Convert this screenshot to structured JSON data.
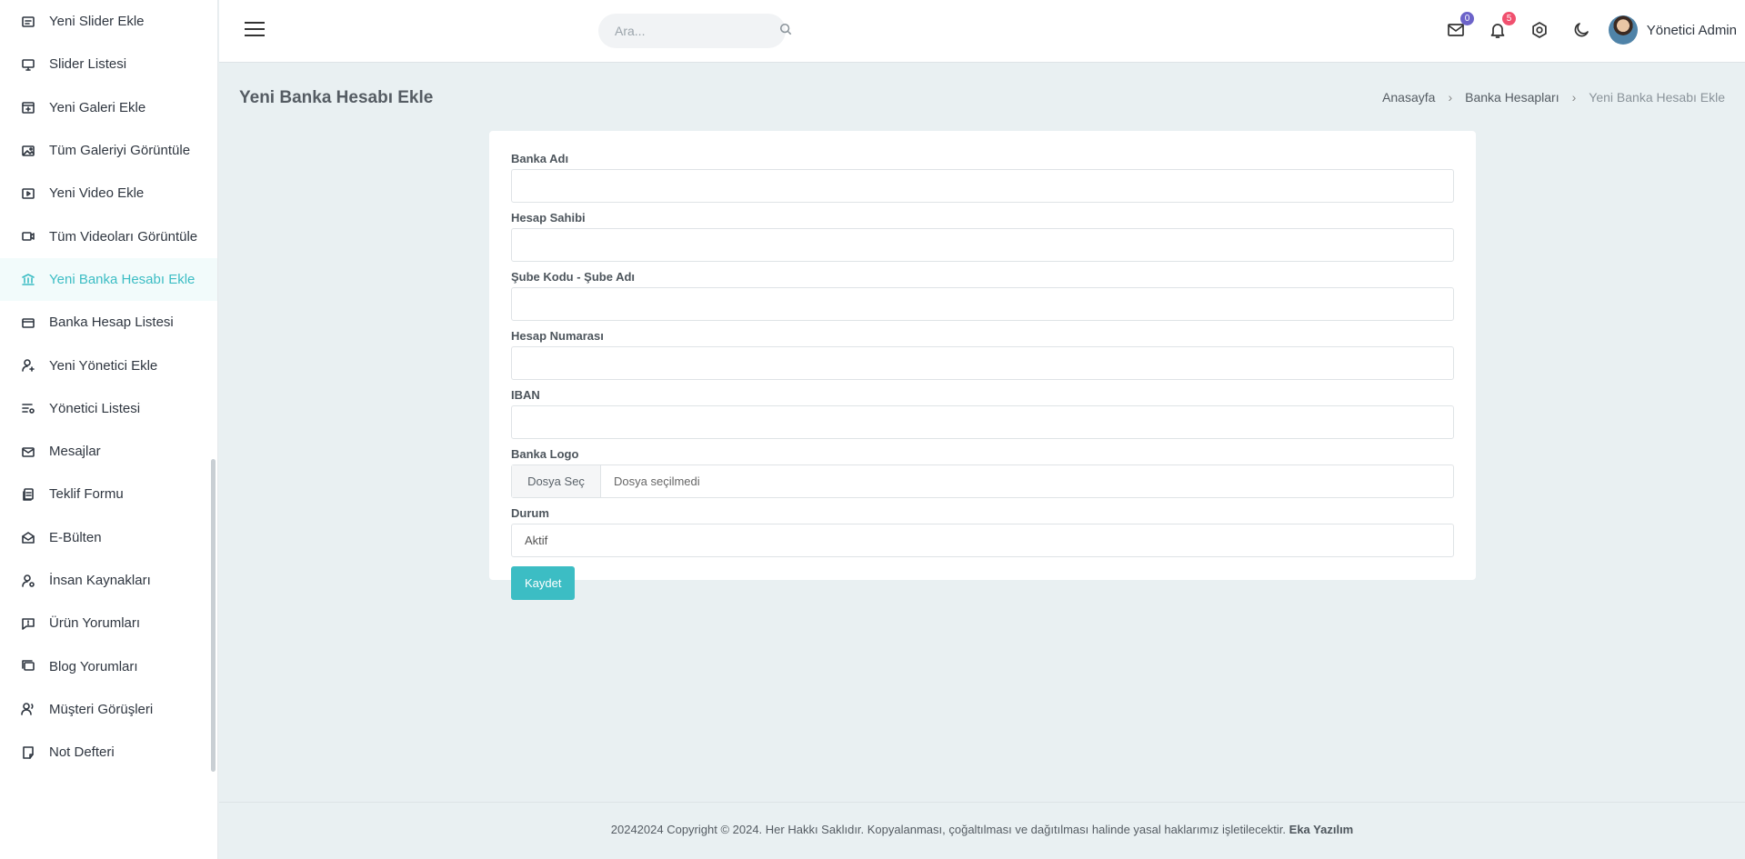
{
  "sidebar": {
    "items": [
      {
        "label": "Yeni Slider Ekle",
        "icon": "slider-add-icon"
      },
      {
        "label": "Slider Listesi",
        "icon": "monitor-icon"
      },
      {
        "label": "Yeni Galeri Ekle",
        "icon": "gallery-add-icon"
      },
      {
        "label": "Tüm Galeriyi Görüntüle",
        "icon": "image-icon"
      },
      {
        "label": "Yeni Video Ekle",
        "icon": "video-add-icon"
      },
      {
        "label": "Tüm Videoları Görüntüle",
        "icon": "video-icon"
      },
      {
        "label": "Yeni Banka Hesabı Ekle",
        "icon": "bank-icon",
        "active": true
      },
      {
        "label": "Banka Hesap Listesi",
        "icon": "credit-card-icon"
      },
      {
        "label": "Yeni Yönetici Ekle",
        "icon": "user-add-icon"
      },
      {
        "label": "Yönetici Listesi",
        "icon": "list-settings-icon"
      },
      {
        "label": "Mesajlar",
        "icon": "mail-icon"
      },
      {
        "label": "Teklif Formu",
        "icon": "file-copy-icon"
      },
      {
        "label": "E-Bülten",
        "icon": "mail-open-icon"
      },
      {
        "label": "İnsan Kaynakları",
        "icon": "user-settings-icon"
      },
      {
        "label": "Ürün Yorumları",
        "icon": "chat-icon"
      },
      {
        "label": "Blog Yorumları",
        "icon": "chat-history-icon"
      },
      {
        "label": "Müşteri Görüşleri",
        "icon": "user-voice-icon"
      },
      {
        "label": "Not Defteri",
        "icon": "sticky-note-icon"
      }
    ]
  },
  "topbar": {
    "search_placeholder": "Ara...",
    "mail_count": "0",
    "notification_count": "5",
    "user_name": "Yönetici Admin"
  },
  "page": {
    "title": "Yeni Banka Hesabı Ekle",
    "breadcrumb": [
      "Anasayfa",
      "Banka Hesapları",
      "Yeni Banka Hesabı Ekle"
    ]
  },
  "form": {
    "bank_name_label": "Banka Adı",
    "bank_name_value": "",
    "holder_label": "Hesap Sahibi",
    "holder_value": "",
    "branch_label": "Şube Kodu - Şube Adı",
    "branch_value": "",
    "account_label": "Hesap Numarası",
    "account_value": "",
    "iban_label": "IBAN",
    "iban_value": "",
    "logo_label": "Banka Logo",
    "file_button": "Dosya Seç",
    "file_status": "Dosya seçilmedi",
    "status_label": "Durum",
    "status_value": "Aktif",
    "save_label": "Kaydet"
  },
  "footer": {
    "text": "20242024 Copyright © 2024. Her Hakkı Saklıdır. Kopyalanması, çoğaltılması ve dağıtılması halinde yasal haklarımız işletilecektir.",
    "company": "Eka Yazılım"
  },
  "colors": {
    "accent": "#3cbdc4",
    "mail_badge": "#6c63c9",
    "notification_badge": "#f0506e",
    "background": "#e9f0f2"
  }
}
